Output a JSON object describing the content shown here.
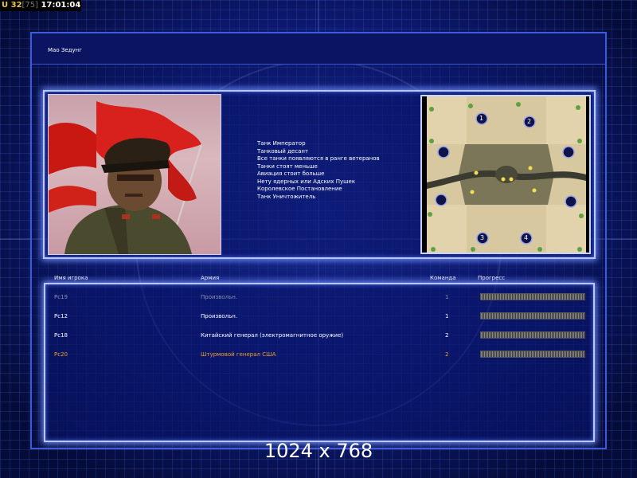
{
  "hud": {
    "prefix": "U",
    "value": "32",
    "bracket_value": "[75]",
    "time": "17:01:04"
  },
  "general_name": "Мао Зедунг",
  "bonuses": [
    "Танк Император",
    "Танковый десант",
    "Все танки появляются в ранге ветеранов",
    "Танки стоят меньше",
    "Авиация стоит больше",
    "Нету ядерных или Адских Пушек",
    "Королевское Постановление",
    "Танк Уничтожитель"
  ],
  "map": {
    "start_positions": [
      "1",
      "2",
      "3",
      "4"
    ]
  },
  "columns": {
    "player": "Имя игрока",
    "army": "Армия",
    "team": "Команда",
    "progress": "Прогресс"
  },
  "players": [
    {
      "name": "Pc19",
      "army": "Произвольн.",
      "team": "1",
      "color": "#8a8fa6",
      "progress": 1.0
    },
    {
      "name": "Pc12",
      "army": "Произвольн.",
      "team": "1",
      "color": "#ffffff",
      "progress": 1.0
    },
    {
      "name": "Pc18",
      "army": "Китайский генерал (электромагнитное оружие)",
      "team": "2",
      "color": "#ffffff",
      "progress": 1.0
    },
    {
      "name": "Pc20",
      "army": "Штурмовой генерал США",
      "team": "2",
      "color": "#f0a020",
      "progress": 1.0
    }
  ],
  "resolution_text": "1024 x 768"
}
